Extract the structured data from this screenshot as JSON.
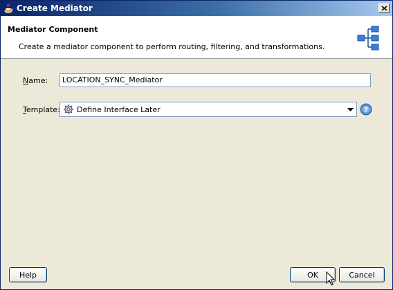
{
  "window": {
    "title": "Create Mediator"
  },
  "header": {
    "title": "Mediator Component",
    "description": "Create a mediator component to perform routing, filtering, and transformations.",
    "icon": "mediator-component-icon"
  },
  "form": {
    "name_label_mnemonic": "N",
    "name_label_rest": "ame:",
    "name_value": "LOCATION_SYNC_Mediator",
    "template_label_mnemonic": "T",
    "template_label_rest": "emplate:",
    "template_selected": "Define Interface Later"
  },
  "buttons": {
    "help": "Help",
    "ok": "OK",
    "cancel": "Cancel"
  },
  "colors": {
    "titlebar_start": "#0a246a",
    "titlebar_end": "#a6caf0",
    "dialog_bg": "#ece9d8"
  }
}
